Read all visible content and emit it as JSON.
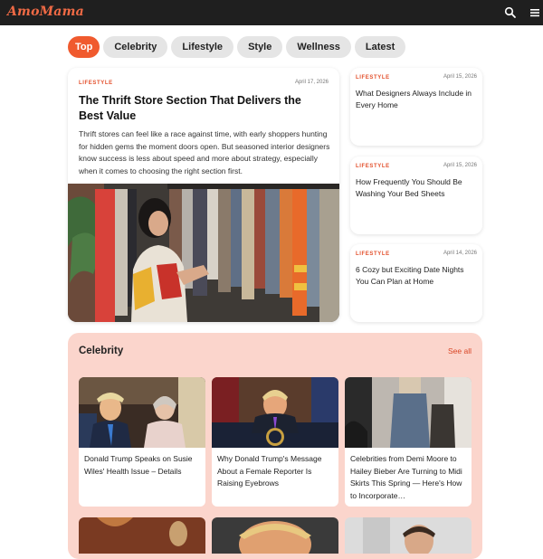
{
  "brand": {
    "name": "AmoMama",
    "accent": "#f05a2e"
  },
  "header": {
    "icons": [
      "search-icon",
      "menu-icon"
    ]
  },
  "tabs": [
    {
      "label": "Top",
      "active": true
    },
    {
      "label": "Celebrity"
    },
    {
      "label": "Lifestyle"
    },
    {
      "label": "Style"
    },
    {
      "label": "Wellness"
    },
    {
      "label": "Latest"
    }
  ],
  "featured": {
    "category": "LIFESTYLE",
    "date": "April 17, 2026",
    "title": "The Thrift Store Section That Delivers the Best Value",
    "description": "Thrift stores can feel like a race against time, with early shoppers hunting for hidden gems the moment doors open. But seasoned interior designers know success is less about speed and more about strategy, especially when it comes to choosing the right section first."
  },
  "side_articles": [
    {
      "category": "LIFESTYLE",
      "date": "April 15, 2026",
      "title": "What Designers Always Include in Every Home"
    },
    {
      "category": "LIFESTYLE",
      "date": "April 15, 2026",
      "title": "How Frequently You Should Be Washing Your Bed Sheets"
    },
    {
      "category": "LIFESTYLE",
      "date": "April 14, 2026",
      "title": "6 Cozy but Exciting Date Nights You Can Plan at Home"
    }
  ],
  "celebrity": {
    "title": "Celebrity",
    "see_all": "See all",
    "articles": [
      {
        "title": "Donald Trump Speaks on Susie Wiles' Health Issue – Details"
      },
      {
        "title": "Why Donald Trump's Message About a Female Reporter Is Raising Eyebrows"
      },
      {
        "title": "Celebrities from Demi Moore to Hailey Bieber Are Turning to Midi Skirts This Spring — Here's How to Incorporate…"
      }
    ]
  }
}
